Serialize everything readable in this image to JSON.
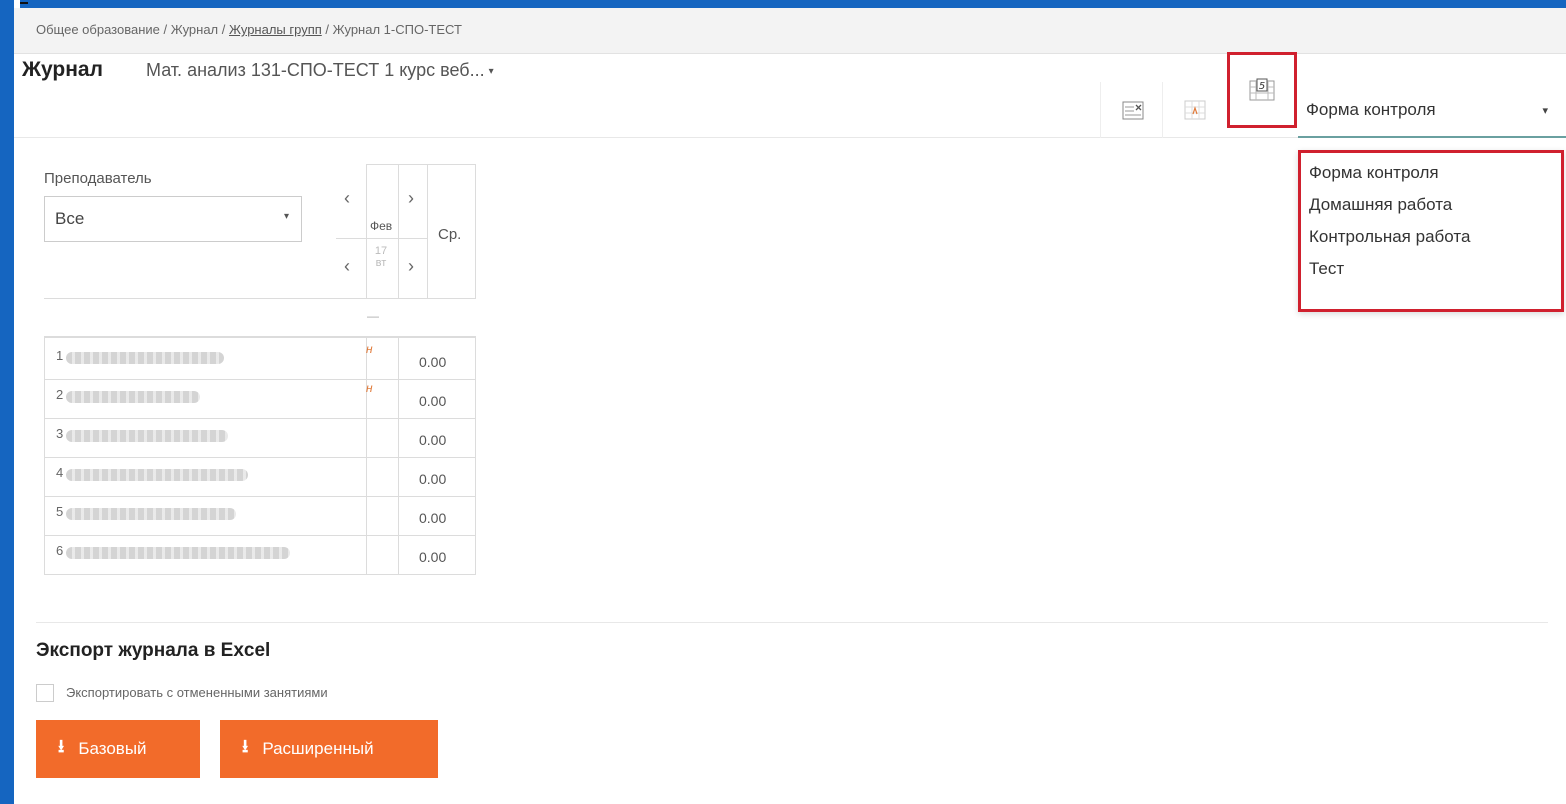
{
  "breadcrumb": {
    "part1": "Общее образование / Журнал / ",
    "link": "Журналы групп",
    "part3": " / Журнал 1-СПО-ТЕСТ"
  },
  "header": {
    "title": "Журнал",
    "subject": "Мат. анализ 131-СПО-ТЕСТ 1 курс веб...",
    "caret": "▾"
  },
  "toolbar": {
    "icons": [
      "clear-table-icon",
      "mark-absent-icon",
      "grade-table-icon"
    ],
    "control_select": "Форма контроля",
    "caret": "▾"
  },
  "control_dropdown": {
    "options": [
      "Форма контроля",
      "Домашняя работа",
      "Контрольная работа",
      "Тест"
    ]
  },
  "filters": {
    "teacher_label": "Преподаватель",
    "teacher_value": "Все",
    "caret": "▾"
  },
  "table": {
    "prev": "‹",
    "next": "›",
    "month": "Фев",
    "day": "17",
    "weekday": "вт",
    "avg_header": "Ср.",
    "dash": "—",
    "rows": [
      {
        "num": "1",
        "mark": "н",
        "avg": "0.00"
      },
      {
        "num": "2",
        "mark": "н",
        "avg": "0.00"
      },
      {
        "num": "3",
        "mark": "",
        "avg": "0.00"
      },
      {
        "num": "4",
        "mark": "",
        "avg": "0.00"
      },
      {
        "num": "5",
        "mark": "",
        "avg": "0.00"
      },
      {
        "num": "6",
        "mark": "",
        "avg": "0.00"
      }
    ]
  },
  "export": {
    "title": "Экспорт журнала в Excel",
    "checkbox_label": "Экспортировать с отмененными занятиями",
    "basic_label": "Базовый",
    "extended_label": "Расширенный",
    "download_glyph": "⭳"
  },
  "colors": {
    "frame": "#1565c0",
    "accent_orange": "#f26b2a",
    "highlight_red": "#d0202e"
  }
}
